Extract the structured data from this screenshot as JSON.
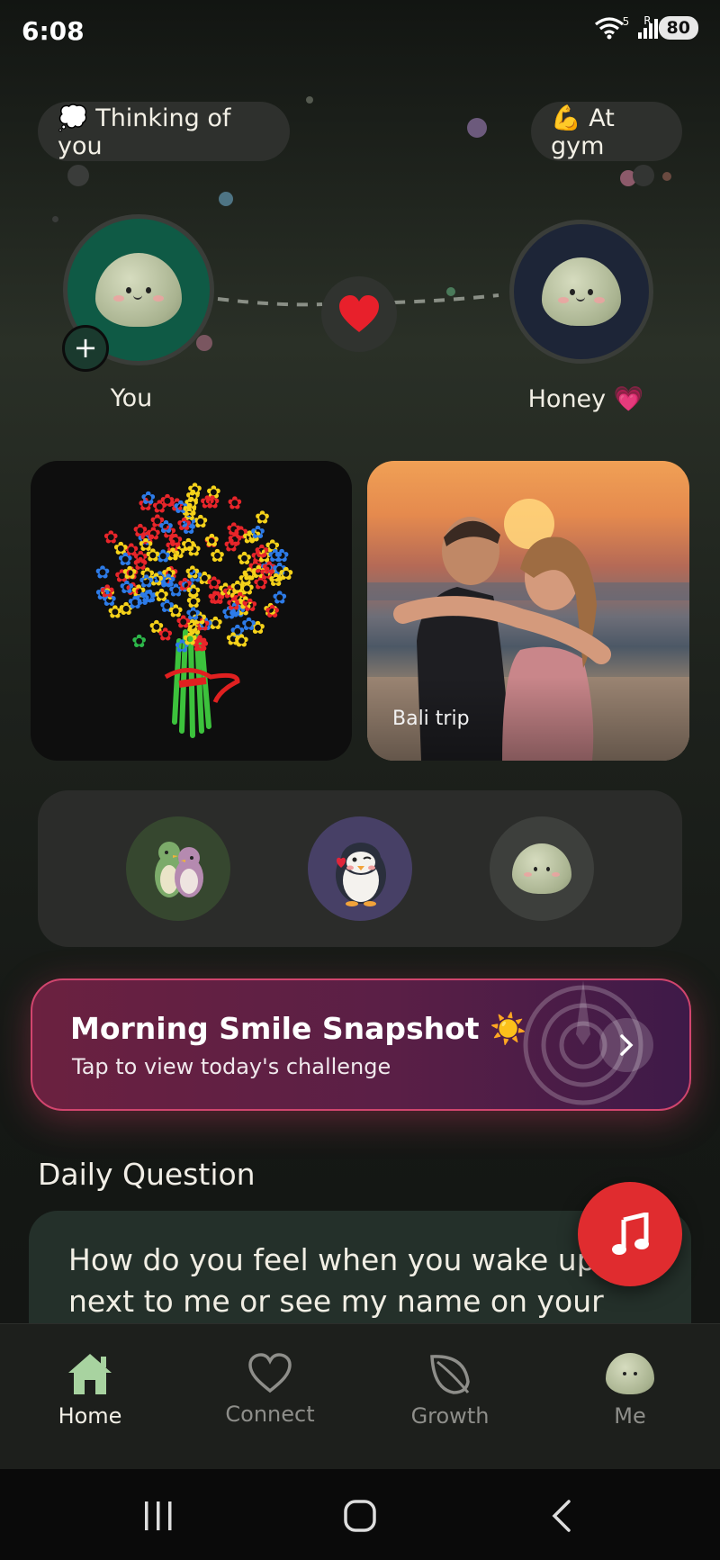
{
  "status_bar": {
    "time": "6:08",
    "battery": "80",
    "wifi_badge": "5",
    "signal_badge": "R"
  },
  "moods": {
    "you": "💭 Thinking of you",
    "honey": "💪 At gym"
  },
  "profiles": {
    "you_name": "You",
    "honey_name": "Honey 💗"
  },
  "photos": {
    "photo_caption": "Bali trip"
  },
  "stickers": [
    "hugging-penguins",
    "kissing-penguin",
    "pebble-buddy"
  ],
  "challenge": {
    "title": "Morning Smile Snapshot ☀️",
    "subtitle": "Tap to view today's challenge"
  },
  "daily_question": {
    "section_title": "Daily Question",
    "text": "How do you feel when you wake up next to me or see my name on your"
  },
  "nav": {
    "home": "Home",
    "connect": "Connect",
    "growth": "Growth",
    "me": "Me"
  },
  "colors": {
    "accent_red": "#e02c2f",
    "nav_active": "#a8d3a0",
    "nav_inactive": "#8e8e8a",
    "challenge_border": "#d1456e"
  }
}
